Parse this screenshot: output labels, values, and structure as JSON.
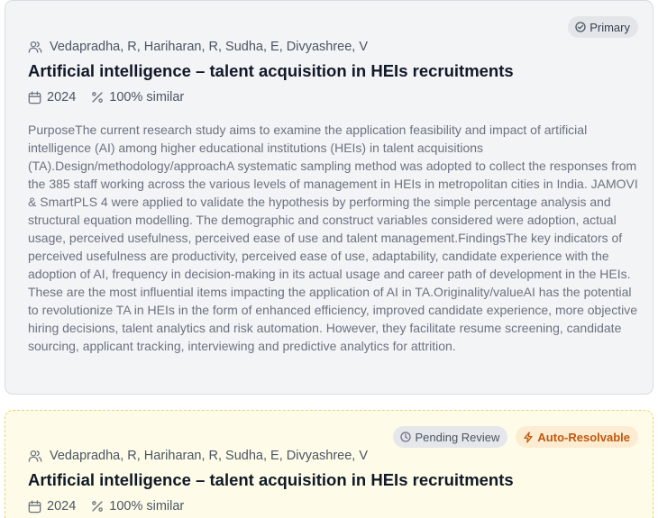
{
  "results": [
    {
      "badges": [
        {
          "label": "Primary",
          "icon": "check-circle-icon"
        }
      ],
      "authors": "Vedapradha, R, Hariharan, R, Sudha, E, Divyashree, V",
      "title": "Artificial intelligence – talent acquisition in HEIs recruitments",
      "year": "2024",
      "similarity": "100% similar",
      "abstract": "PurposeThe current research study aims to examine the application feasibility and impact of artificial intelligence (AI) among higher educational institutions (HEIs) in talent acquisitions (TA).Design/methodology/approachA systematic sampling method was adopted to collect the responses from the 385 staff working across the various levels of management in HEIs in metropolitan cities in India. JAMOVI & SmartPLS 4 were applied to validate the hypothesis by performing the simple percentage analysis and structural equation modelling. The demographic and construct variables considered were adoption, actual usage, perceived usefulness, perceived ease of use and talent management.FindingsThe key indicators of perceived usefulness are productivity, perceived ease of use, adaptability, candidate experience with the adoption of AI, frequency in decision-making in its actual usage and career path of development in the HEIs. These are the most influential items impacting the application of AI in TA.Originality/valueAI has the potential to revolutionize TA in HEIs in the form of enhanced efficiency, improved candidate experience, more objective hiring decisions, talent analytics and risk automation. However, they facilitate resume screening, candidate sourcing, applicant tracking, interviewing and predictive analytics for attrition."
    },
    {
      "badges": [
        {
          "label": "Pending Review",
          "icon": "clock-icon"
        },
        {
          "label": "Auto-Resolvable",
          "icon": "lightning-icon"
        }
      ],
      "authors": "Vedapradha, R, Hariharan, R, Sudha, E, Divyashree, V",
      "title": "Artificial intelligence – talent acquisition in HEIs recruitments",
      "year": "2024",
      "similarity": "100% similar"
    }
  ],
  "colors": {
    "primary_card_bg": "#f3f4f6",
    "pending_card_bg": "#fefce8",
    "pending_card_border": "#ecd27e",
    "auto_resolvable": "#c2570c"
  }
}
